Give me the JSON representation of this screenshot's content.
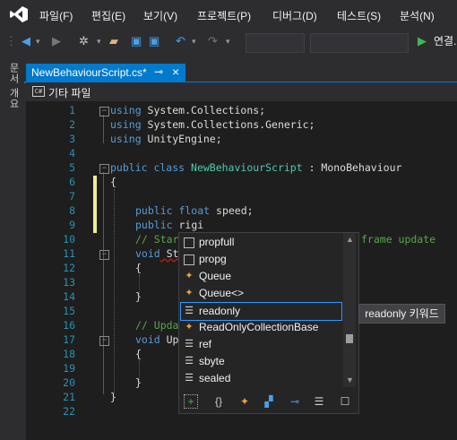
{
  "menu": [
    "파일(F)",
    "편집(E)",
    "보기(V)",
    "프로젝트(P)",
    "디버그(D)",
    "테스트(S)",
    "분석(N)"
  ],
  "toolbar": {
    "connect_label": "연결."
  },
  "left_strip": {
    "label": "문서 개요"
  },
  "tab": {
    "title": "NewBehaviourScript.cs*",
    "pin": "⊸",
    "close": "×"
  },
  "navbar": {
    "label": "기타 파일"
  },
  "editor": {
    "line_numbers": [
      "1",
      "2",
      "3",
      "4",
      "5",
      "6",
      "7",
      "8",
      "9",
      "10",
      "11",
      "12",
      "13",
      "14",
      "15",
      "16",
      "17",
      "18",
      "19",
      "20",
      "21",
      "22"
    ],
    "lines": {
      "l1": [
        "using System.Collections;"
      ],
      "l2": [
        "using System.Collections.Generic;"
      ],
      "l3": [
        "using UnityEngine;"
      ],
      "l5_kw": "public class ",
      "l5_name": "NewBehaviourScript",
      "l5_rest": " : MonoBehaviour",
      "l6": "{",
      "l8_kw": "public float",
      "l8_rest": " speed;",
      "l9_kw": "public",
      "l9_rest": " rigi",
      "l10_cm": "// Star",
      "l10_cm2": "frame update",
      "l11_kw": "void",
      "l11_rest": " St",
      "l12": "{",
      "l14": "}",
      "l16_cm": "// Upda",
      "l17_kw": "void",
      "l17_rest": " Up",
      "l18": "{",
      "l20": "}",
      "l21": "}"
    }
  },
  "completion": {
    "items": [
      {
        "label": "propfull",
        "icon": "snippet-icon"
      },
      {
        "label": "propg",
        "icon": "snippet-icon"
      },
      {
        "label": "Queue",
        "icon": "class-icon"
      },
      {
        "label": "Queue<>",
        "icon": "class-icon"
      },
      {
        "label": "readonly",
        "icon": "keyword-icon"
      },
      {
        "label": "ReadOnlyCollectionBase",
        "icon": "class-icon"
      },
      {
        "label": "ref",
        "icon": "keyword-icon"
      },
      {
        "label": "sbyte",
        "icon": "keyword-icon"
      },
      {
        "label": "sealed",
        "icon": "keyword-icon"
      }
    ],
    "selected": "readonly",
    "tooltip": "readonly 키워드"
  },
  "colors": {
    "accent": "#007acc",
    "keyword": "#569cd6",
    "type": "#4ec9b0",
    "comment": "#57a64a",
    "line_number": "#2b91af"
  }
}
